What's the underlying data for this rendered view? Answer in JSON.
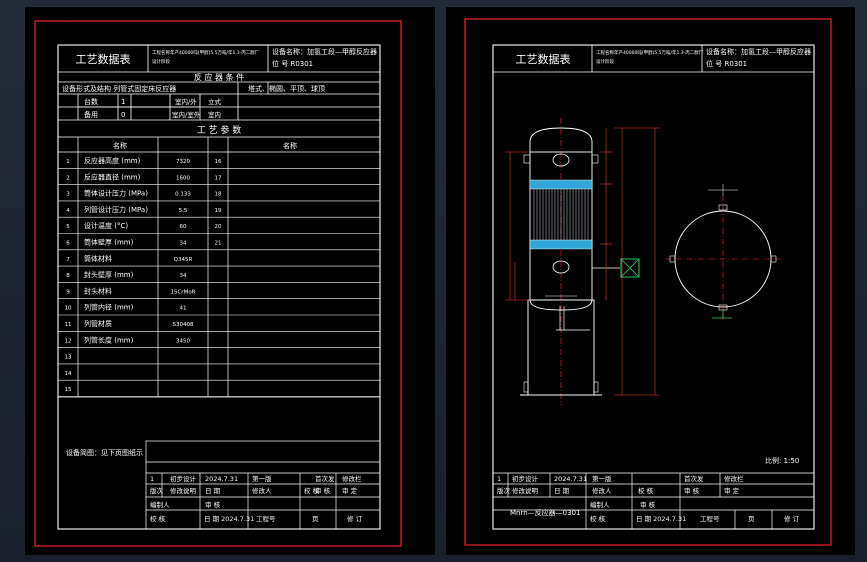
{
  "left_sheet": {
    "title": "工艺数据表",
    "project_label": "工程名称",
    "project_text": "年产40000吨(甲醇)5.5万吨/年1.3-丙二醇厂",
    "section_label": "设计阶段",
    "equipment_name_text": "设备名称：加氢工段—甲醇反应器",
    "equipment_no_text": "位 号 R0301",
    "reactor_heading": "反 应 器 条 件",
    "form_row": "设备形式及结构 列管式固定床反应器",
    "type_row": "塔式、椭圆、平顶、球顶",
    "qty_a": "台数",
    "qty_a_val": "1",
    "qty_b": "备用",
    "qty_b_val": "0",
    "place_label": "室内/外",
    "place_val": "室内/室外",
    "place2_label": "立式",
    "place2_val": "室内",
    "params_heading": "工 艺 参 数",
    "col_name": "名称",
    "col_name2": "名称",
    "params": [
      {
        "no": "1",
        "name": "反应器高度 (mm)",
        "value": "7320",
        "ref": "16"
      },
      {
        "no": "2",
        "name": "反应器直径 (mm)",
        "value": "1600",
        "ref": "17"
      },
      {
        "no": "3",
        "name": "筒体设计压力 (MPa)",
        "value": "0.133",
        "ref": "18"
      },
      {
        "no": "4",
        "name": "列管设计压力 (MPa)",
        "value": "5.5",
        "ref": "19"
      },
      {
        "no": "5",
        "name": "设计温度 (°C)",
        "value": "60",
        "ref": "20"
      },
      {
        "no": "6",
        "name": "筒体壁厚 (mm)",
        "value": "34",
        "ref": "21"
      },
      {
        "no": "7",
        "name": "筒体材料",
        "value": "Q345R",
        "ref": ""
      },
      {
        "no": "8",
        "name": "封头壁厚 (mm)",
        "value": "34",
        "ref": ""
      },
      {
        "no": "9",
        "name": "封头材料",
        "value": "15CrMoR",
        "ref": ""
      },
      {
        "no": "10",
        "name": "列管内径 (mm)",
        "value": "41",
        "ref": ""
      },
      {
        "no": "11",
        "name": "列管材质",
        "value": "S30408",
        "ref": ""
      },
      {
        "no": "12",
        "name": "列管长度 (mm)",
        "value": "3450",
        "ref": ""
      },
      {
        "no": "13",
        "name": "",
        "value": "",
        "ref": ""
      },
      {
        "no": "14",
        "name": "",
        "value": "",
        "ref": ""
      },
      {
        "no": "15",
        "name": "",
        "value": "",
        "ref": ""
      }
    ],
    "sketch_note": "设备简图：见下页图纸示",
    "tb_rows": [
      [
        "1",
        "初步设计",
        "2024.7.31",
        "第一版",
        "",
        "首次发",
        "修改栏"
      ],
      [
        "版次",
        "修改说明",
        "日 期",
        "修改人",
        "校 核",
        "审 核",
        "审 定"
      ]
    ],
    "tb_made": "编制人",
    "tb_check": "校 核",
    "tb_review": "审 核",
    "tb_date": "日 期 2024.7.31",
    "tb_drawing_no": "工程号",
    "tb_page": "页",
    "tb_version": "修 订"
  },
  "right_sheet": {
    "title": "工艺数据表",
    "project_label": "工程名称",
    "project_text": "年产40000吨(甲醇)5.5万吨/年1.3-丙二醇厂",
    "section_label": "设计阶段",
    "equipment_name_text": "设备名称：加氢工段—甲醇反应器",
    "equipment_no_text": "位 号 R0301",
    "scale": "比例: 1:50",
    "tb_rows": [
      [
        "1",
        "初步设计",
        "2024.7.31",
        "第一版",
        "",
        "首次发",
        "修改栏"
      ],
      [
        "版次",
        "修改说明",
        "日 期",
        "修改人",
        "校 核",
        "审 核",
        "审 定"
      ]
    ],
    "tb_made": "编制人",
    "tb_check": "校 核",
    "tb_review": "审 核",
    "tb_date": "日 期 2024.7.31",
    "drawing_no": "Mnrn—反应器—0301",
    "tb_drawing_no": "工程号",
    "tb_page": "页",
    "tb_version": "修 订"
  },
  "colors": {
    "background": "#1d2430",
    "sheet": "#000000",
    "frame": "#d21f2a",
    "line": "#ffffff",
    "dim": "#ff3333",
    "text_yellow": "#ffff66",
    "packing": "#33a6d9",
    "nozzle": "#33cc66"
  }
}
